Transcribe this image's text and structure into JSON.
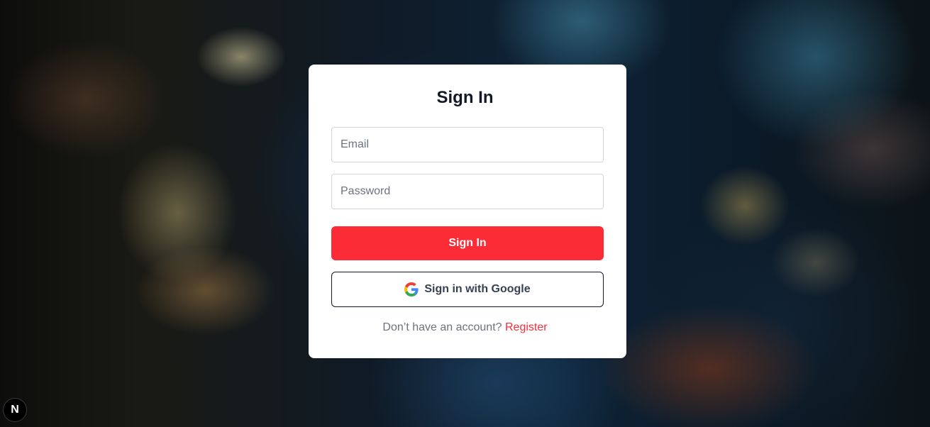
{
  "login": {
    "title": "Sign In",
    "email_placeholder": "Email",
    "password_placeholder": "Password",
    "submit_label": "Sign In",
    "google_label": "Sign in with Google",
    "footer_prompt": "Don’t have an account?",
    "register_label": "Register"
  },
  "badge": {
    "letter": "N"
  },
  "colors": {
    "accent": "#fb2c36",
    "card": "#ffffff",
    "title": "#111827",
    "muted": "#6b7280"
  },
  "icons": [
    "google-icon",
    "nextjs-icon"
  ]
}
